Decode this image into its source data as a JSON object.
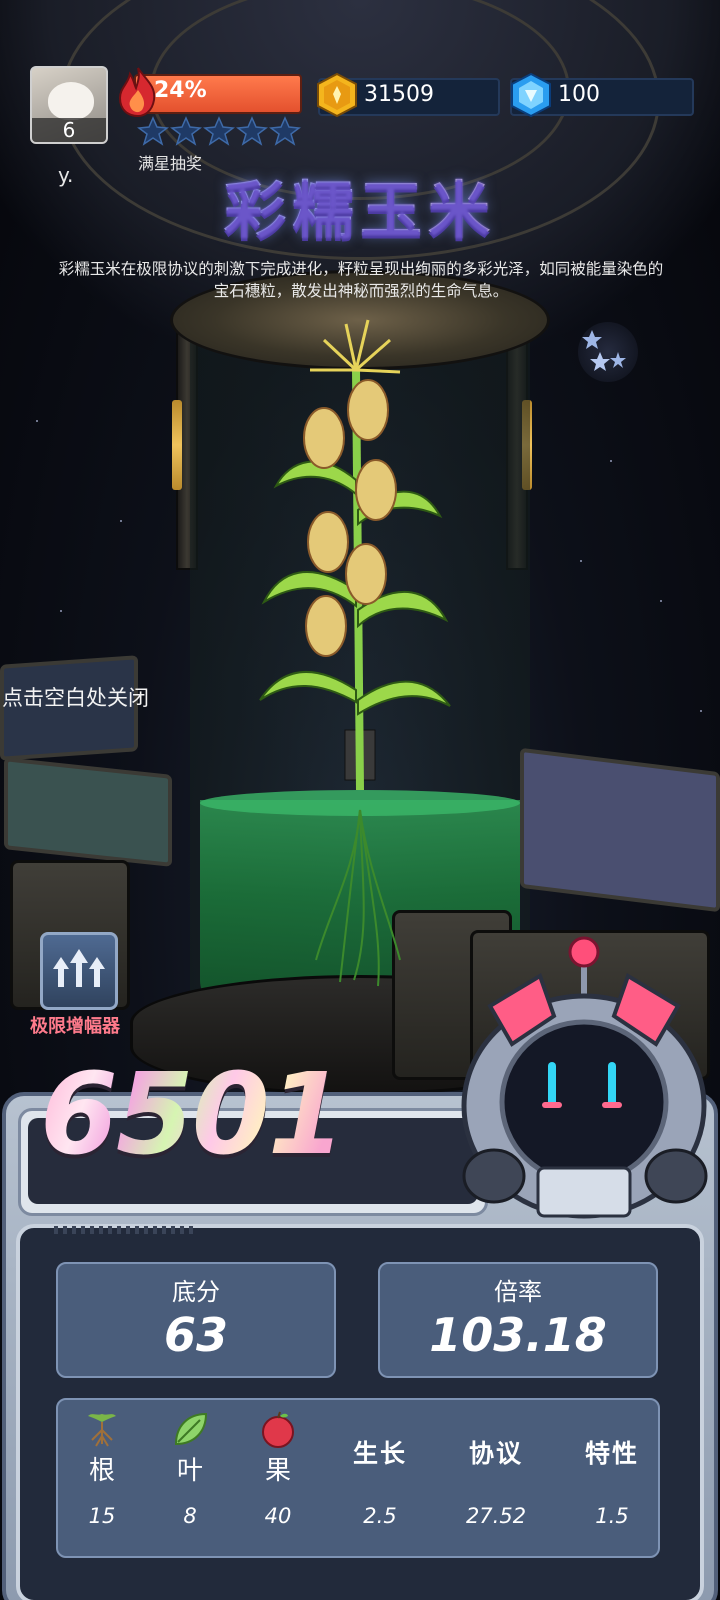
{
  "header": {
    "level": "6",
    "user_name": "y.",
    "energy_percent": "24%",
    "energy_fill_fraction": 0.24,
    "star_count": 5,
    "full_star_prize_label": "满星抽奖",
    "gold_amount": "31509",
    "gem_amount": "100"
  },
  "crop": {
    "title": "彩糯玉米",
    "description": "彩糯玉米在极限协议的刺激下完成进化，籽粒呈现出绚丽的多彩光泽，如同被能量染色的宝石穗粒，散发出神秘而强烈的生命气息。"
  },
  "hints": {
    "close_hint": "点击空白处关闭",
    "booster_label": "极限增幅器"
  },
  "score": {
    "total": "6501",
    "base_label": "底分",
    "base_value": "63",
    "multiplier_label": "倍率",
    "multiplier_value": "103.18"
  },
  "details": [
    {
      "label": "根",
      "value": "15",
      "icon": "root-icon"
    },
    {
      "label": "叶",
      "value": "8",
      "icon": "leaf-icon"
    },
    {
      "label": "果",
      "value": "40",
      "icon": "apple-icon"
    },
    {
      "label": "生长",
      "value": "2.5"
    },
    {
      "label": "协议",
      "value": "27.52"
    },
    {
      "label": "特性",
      "value": "1.5"
    }
  ],
  "colors": {
    "energy": "#e4512e",
    "panel_card": "#4a5d7b",
    "booster_label": "#ff7b8c",
    "liquid": "#2f9a55"
  }
}
